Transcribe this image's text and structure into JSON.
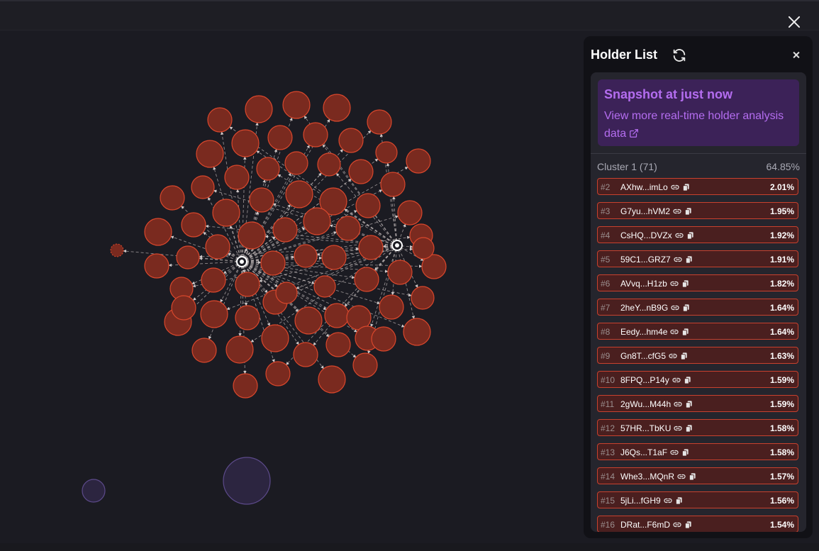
{
  "colors": {
    "background": "#1b1b22",
    "node_fill": "#7a2a1f",
    "node_stroke": "#d9472c",
    "hub": "#ffffff",
    "edge": "#b9b2b2",
    "other_cluster": "#2c2540",
    "other_cluster_stroke": "#5c4a8a",
    "accent_purple": "#b46df0",
    "row_border": "#c8412e",
    "row_fill": "#4a1f1f"
  },
  "panel": {
    "title": "Holder List",
    "refresh_icon": "refresh-icon",
    "close_icon": "close-icon"
  },
  "snapshot": {
    "title": "Snapshot at just now",
    "link_text": "View more real-time holder analysis data",
    "link_icon": "external-link-icon"
  },
  "cluster": {
    "name": "Cluster 1 (71)",
    "percent": "64.85%"
  },
  "holders": [
    {
      "rank": "#2",
      "address": "AXhw...imLo",
      "percent": "2.01%"
    },
    {
      "rank": "#3",
      "address": "G7yu...hVM2",
      "percent": "1.95%"
    },
    {
      "rank": "#4",
      "address": "CsHQ...DVZx",
      "percent": "1.92%"
    },
    {
      "rank": "#5",
      "address": "59C1...GRZ7",
      "percent": "1.91%"
    },
    {
      "rank": "#6",
      "address": "AVvq...H1zb",
      "percent": "1.82%"
    },
    {
      "rank": "#7",
      "address": "2heY...nB9G",
      "percent": "1.64%"
    },
    {
      "rank": "#8",
      "address": "Eedy...hm4e",
      "percent": "1.64%"
    },
    {
      "rank": "#9",
      "address": "Gn8T...cfG5",
      "percent": "1.63%"
    },
    {
      "rank": "#10",
      "address": "8FPQ...P14y",
      "percent": "1.59%"
    },
    {
      "rank": "#11",
      "address": "2gWu...M44h",
      "percent": "1.59%"
    },
    {
      "rank": "#12",
      "address": "57HR...TbKU",
      "percent": "1.58%"
    },
    {
      "rank": "#13",
      "address": "J6Qs...T1aF",
      "percent": "1.58%"
    },
    {
      "rank": "#14",
      "address": "Whe3...MQnR",
      "percent": "1.57%"
    },
    {
      "rank": "#15",
      "address": "5jLi...fGH9",
      "percent": "1.56%"
    },
    {
      "rank": "#16",
      "address": "DRat...F6mD",
      "percent": "1.54%"
    }
  ]
}
